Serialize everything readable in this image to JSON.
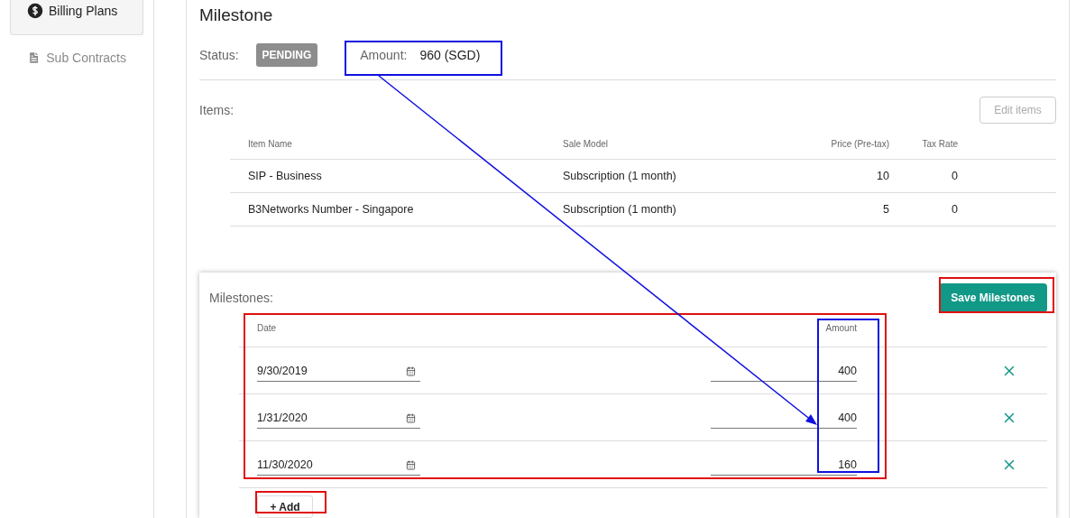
{
  "sidebar": {
    "items": [
      {
        "label": "Billing Plans",
        "kind": "dollar",
        "selected": true
      },
      {
        "label": "Sub Contracts",
        "kind": "file",
        "selected": false
      }
    ]
  },
  "title": "Milestone",
  "status": {
    "label": "Status:",
    "value": "PENDING"
  },
  "amount": {
    "label": "Amount:",
    "value": "960 (SGD)"
  },
  "items": {
    "label": "Items:",
    "edit_button": {
      "label": "Edit items",
      "disabled": true
    },
    "columns": [
      "Item Name",
      "Sale Model",
      "Price (Pre-tax)",
      "Tax Rate"
    ],
    "rows": [
      [
        "SIP - Business",
        "Subscription (1 month)",
        "10",
        "0"
      ],
      [
        "B3Networks Number - Singapore",
        "Subscription (1 month)",
        "5",
        "0"
      ]
    ]
  },
  "milestones": {
    "label": "Milestones:",
    "save_button": "Save Milestones",
    "columns": [
      "Date",
      "Amount"
    ],
    "rows": [
      {
        "date": "9/30/2019",
        "amount": "400"
      },
      {
        "date": "1/31/2020",
        "amount": "400"
      },
      {
        "date": "11/30/2020",
        "amount": "160"
      }
    ],
    "add_button": "+ Add"
  }
}
